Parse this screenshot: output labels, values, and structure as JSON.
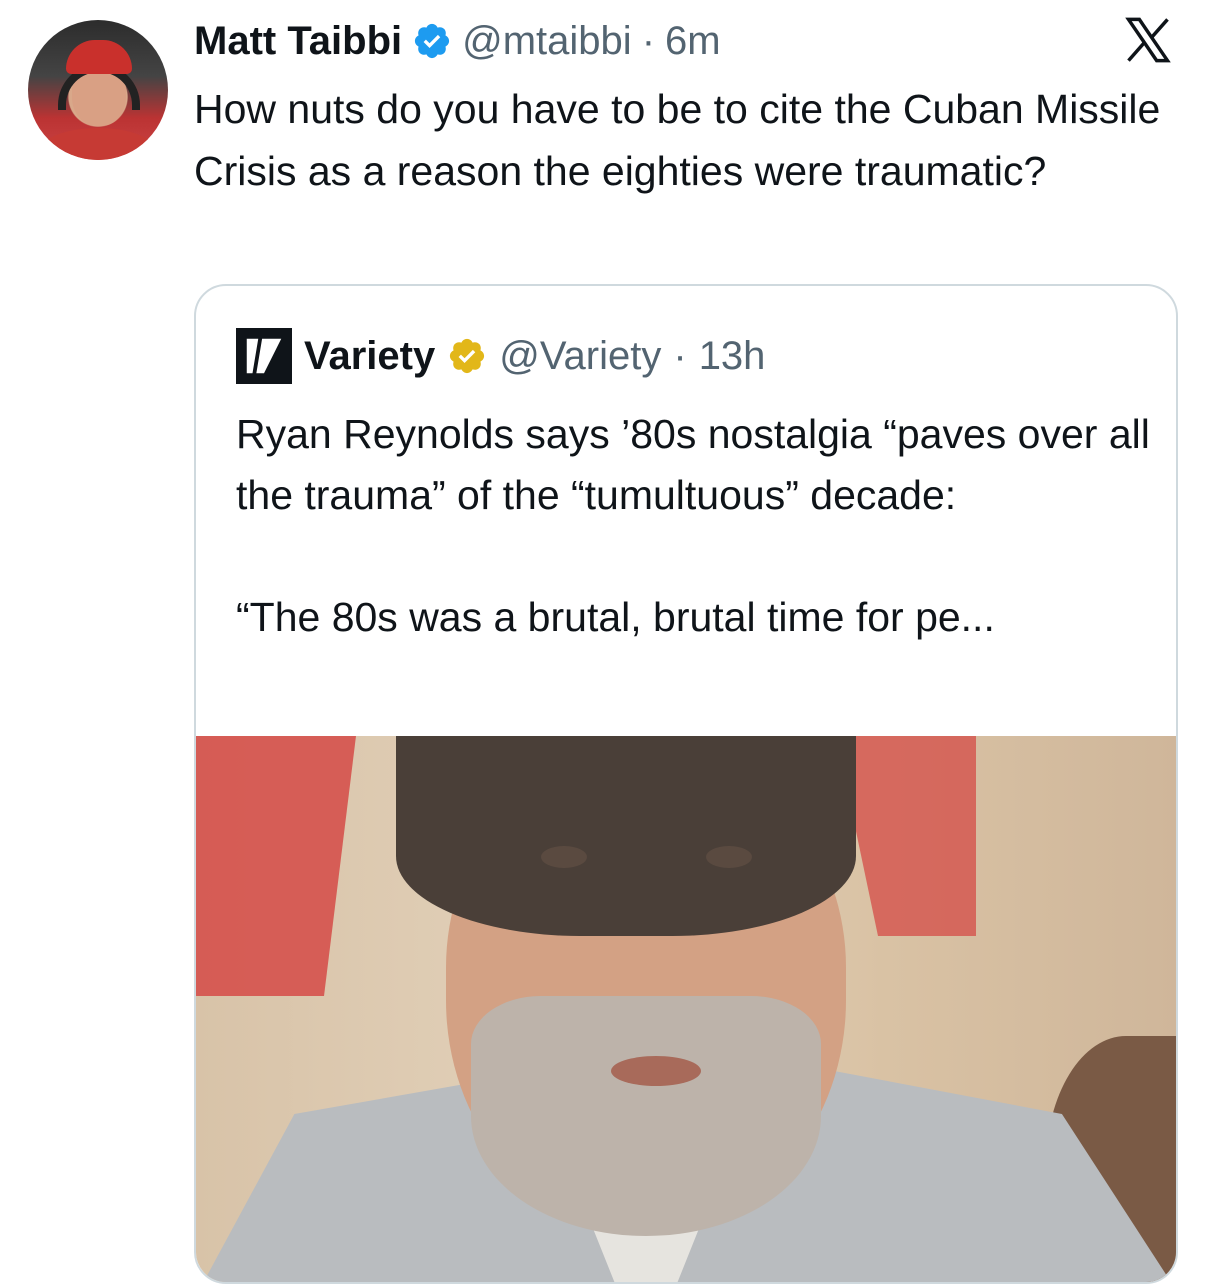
{
  "tweet": {
    "author_name": "Matt Taibbi",
    "handle": "@mtaibbi",
    "separator": "·",
    "time": "6m",
    "text": "How nuts do you have to be to cite the Cuban Missile Crisis as a reason the eighties were traumatic?"
  },
  "quoted_tweet": {
    "author_name": "Variety",
    "logo_letter": "V",
    "handle": "@Variety",
    "separator": "·",
    "time": "13h",
    "text": "Ryan Reynolds says ’80s nostalgia “paves over all the trauma” of the “tumultuous” decade:\n\n“The 80s was a brutal, brutal time for pe..."
  },
  "icons": {
    "verified_blue": "verified-badge-icon",
    "verified_gold": "verified-gold-badge-icon",
    "x_logo": "x-logo-icon"
  },
  "colors": {
    "verified_blue": "#1d9bf0",
    "verified_gold": "#e2b719",
    "secondary_text": "#536471",
    "border": "#cfd9de"
  }
}
